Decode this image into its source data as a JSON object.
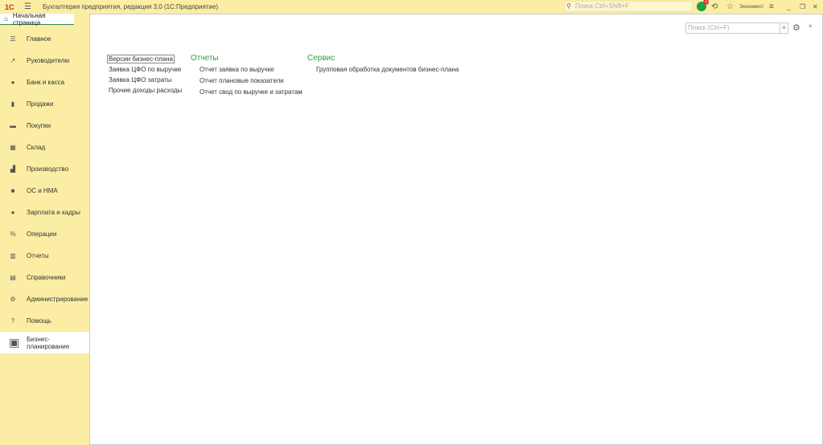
{
  "app": {
    "logo": "1С",
    "title": "Бухгалтерия предприятия, редакция 3.0  (1С:Предприятие)",
    "search_placeholder": "Поиск Ctrl+Shift+F",
    "notifications": "1",
    "user": "Экономист"
  },
  "home_tab": "Начальная страница",
  "sidebar": {
    "items": [
      {
        "label": "Главное",
        "icon": "☰"
      },
      {
        "label": "Руководителю",
        "icon": "↗"
      },
      {
        "label": "Банк и касса",
        "icon": "●"
      },
      {
        "label": "Продажи",
        "icon": "▮"
      },
      {
        "label": "Покупки",
        "icon": "▬"
      },
      {
        "label": "Склад",
        "icon": "▦"
      },
      {
        "label": "Производство",
        "icon": "▟"
      },
      {
        "label": "ОС и НМА",
        "icon": "■"
      },
      {
        "label": "Зарплата и кадры",
        "icon": "●"
      },
      {
        "label": "Операции",
        "icon": "%"
      },
      {
        "label": "Отчеты",
        "icon": "▥"
      },
      {
        "label": "Справочники",
        "icon": "▤"
      },
      {
        "label": "Администрирование",
        "icon": "⚙"
      },
      {
        "label": "Помощь",
        "icon": "?"
      },
      {
        "label": "Бизнес-планирование",
        "icon": "▣"
      }
    ]
  },
  "main": {
    "search_placeholder": "Поиск (Ctrl+F)",
    "col1": [
      "Версии бизнес-плана",
      "Заявка ЦФО по выручке",
      "Заявка ЦФО затраты",
      "Прочие доходы расходы"
    ],
    "reports": {
      "title": "Отчеты",
      "items": [
        "Отчет заявка по выручке",
        "Отчет плановые показатели",
        "Отчет свод по выручке и затратам"
      ]
    },
    "service": {
      "title": "Сервис",
      "items": [
        "Групповая обработка документов бизнес-плана"
      ]
    }
  }
}
